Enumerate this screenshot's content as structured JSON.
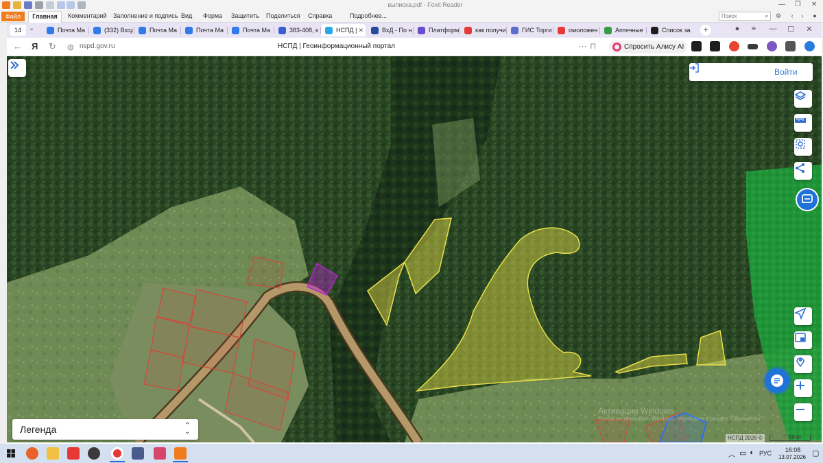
{
  "foxit": {
    "document_title": "выписка.pdf - Foxit Reader",
    "menu": {
      "file": "Файл",
      "home": "Главная",
      "items": [
        "Комментарий",
        "Заполнение и подпись",
        "Вид",
        "Форма",
        "Защитить",
        "Поделиться",
        "Справка",
        "Подробнее..."
      ]
    },
    "search_placeholder": "Поиск"
  },
  "browser": {
    "tab_count": "14",
    "tabs": [
      {
        "label": "Почта Ma",
        "favicon": "mail-icon",
        "color": "#2f7bea"
      },
      {
        "label": "(332) Вход",
        "favicon": "mail-icon",
        "color": "#2f7bea"
      },
      {
        "label": "Почта Ma",
        "favicon": "mail-icon",
        "color": "#2f7bea"
      },
      {
        "label": "Почта Ma",
        "favicon": "mail-icon",
        "color": "#2f7bea"
      },
      {
        "label": "Почта Ma",
        "favicon": "mail-icon",
        "color": "#2f7bea"
      },
      {
        "label": "383-408, к",
        "favicon": "link-icon",
        "color": "#3a5fd0"
      },
      {
        "label": "НСПД |",
        "favicon": "nspd-icon",
        "color": "#2aa6e0",
        "active": true
      },
      {
        "label": "ВхД - По н",
        "favicon": "inbox-icon",
        "color": "#244a9c"
      },
      {
        "label": "Платформ",
        "favicon": "platform-icon",
        "color": "#6a4bc9"
      },
      {
        "label": "как получи",
        "favicon": "yandex-icon",
        "color": "#e53935"
      },
      {
        "label": "ГИС Торги",
        "favicon": "gis-icon",
        "color": "#5b6ec8"
      },
      {
        "label": "омоложен",
        "favicon": "yandex-icon",
        "color": "#e53935"
      },
      {
        "label": "Аптечные",
        "favicon": "pharmacy-icon",
        "color": "#3a9b45"
      },
      {
        "label": "Список за",
        "favicon": "list-icon",
        "color": "#1e1e1e"
      }
    ],
    "url": "nspd.gov.ru",
    "page_title": "НСПД | Геоинформационный портал",
    "alice_label": "Спросить Алису AI"
  },
  "map": {
    "login_label": "Войти",
    "legend_label": "Легенда",
    "watermark_line1": "Активация Windows",
    "watermark_line2": "Чтобы активировать Windows, перейдите в раздел \"Параметры\".",
    "copyright": "НСПД 2026 ©",
    "scale_label": "50 m",
    "right_tools": [
      "layers-icon",
      "ruler-icon",
      "select-area-icon",
      "share-icon",
      "assistant-icon"
    ],
    "bottom_tools": [
      "locate-arrow-icon",
      "map-mode-icon",
      "pin-location-icon",
      "zoom-in-icon",
      "zoom-out-icon"
    ],
    "colors": {
      "parcel_yellow": "#e9e04a",
      "parcel_red": "#d04a3a",
      "parcel_purple": "#b028c8",
      "parcel_blue": "#2f6ff0",
      "forest_zone": "#1fa13a",
      "road_brown": "#8c6a3a"
    }
  },
  "taskbar": {
    "apps": [
      "firefox-icon",
      "explorer-icon",
      "yandex-icon",
      "clipboard-icon",
      "yandex-browser-icon",
      "printer-icon",
      "calendar-icon",
      "foxit-icon"
    ],
    "language": "РУС",
    "time": "16:08",
    "date": "13.07.2026"
  }
}
